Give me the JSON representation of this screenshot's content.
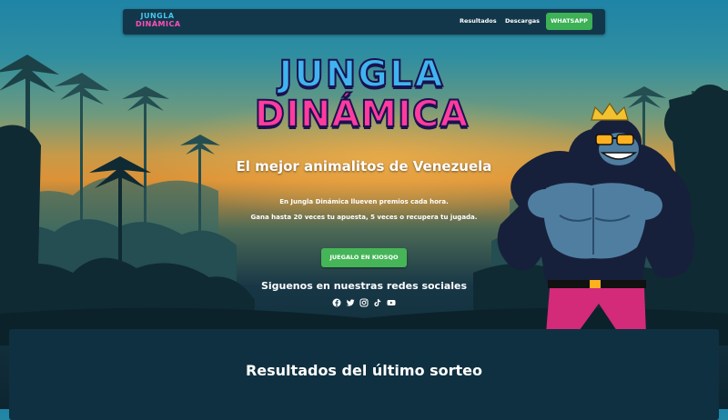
{
  "nav": {
    "logo_line1": "JUNGLA",
    "logo_line2": "DINÁMICA",
    "results_label": "Resultados",
    "downloads_label": "Descargas",
    "whatsapp_label": "WHATSAPP"
  },
  "hero": {
    "logo_line1": "JUNGLA",
    "logo_line2": "DINÁMICA",
    "tagline": "El mejor animalitos de Venezuela",
    "description_line1": "En Jungla Dinámica llueven premios cada hora.",
    "description_line2": "Gana hasta 20 veces tu apuesta, 5 veces o recupera tu jugada.",
    "cta_label": "JUEGALO EN KIOSQO",
    "social_title": "Siguenos en nuestras redes sociales",
    "social_icons": [
      "facebook-icon",
      "twitter-icon",
      "instagram-icon",
      "tiktok-icon",
      "youtube-icon"
    ]
  },
  "results": {
    "title": "Resultados del último sorteo"
  },
  "colors": {
    "navbar_bg": "#13374a",
    "button_green": "#3cb155",
    "logo_blue": "#3fb4ee",
    "logo_pink": "#ff3b9e",
    "results_bg": "#0f3041"
  }
}
